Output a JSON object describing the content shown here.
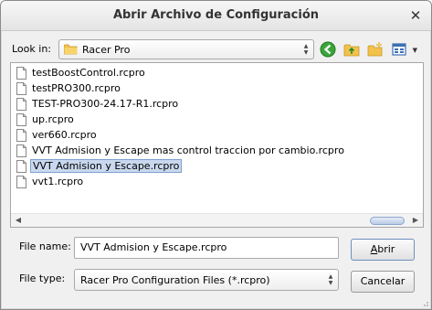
{
  "dialog": {
    "title": "Abrir Archivo de Configuración",
    "close_icon": "close-icon"
  },
  "look_in": {
    "label": "Look in:",
    "value": "Racer Pro"
  },
  "toolbar": {
    "icons": [
      "back-icon",
      "up-folder-icon",
      "new-folder-icon",
      "view-menu-icon"
    ]
  },
  "files": [
    "testBoostControl.rcpro",
    "testPRO300.rcpro",
    "TEST-PRO300-24.17-R1.rcpro",
    "up.rcpro",
    "ver660.rcpro",
    "VVT Admision y Escape mas control traccion por cambio.rcpro",
    "VVT Admision y Escape.rcpro",
    "vvt1.rcpro"
  ],
  "selected_file": "VVT Admision y Escape.rcpro",
  "file_name": {
    "label": "File name:",
    "value": "VVT Admision y Escape.rcpro"
  },
  "file_type": {
    "label": "File type:",
    "value": "Racer Pro Configuration Files (*.rcpro)"
  },
  "buttons": {
    "open_first": "A",
    "open_rest": "brir",
    "cancel": "Cancelar"
  },
  "colors": {
    "selection": "#c9d8ee",
    "folder": "#f2c24a",
    "back_green": "#3aa53a"
  }
}
